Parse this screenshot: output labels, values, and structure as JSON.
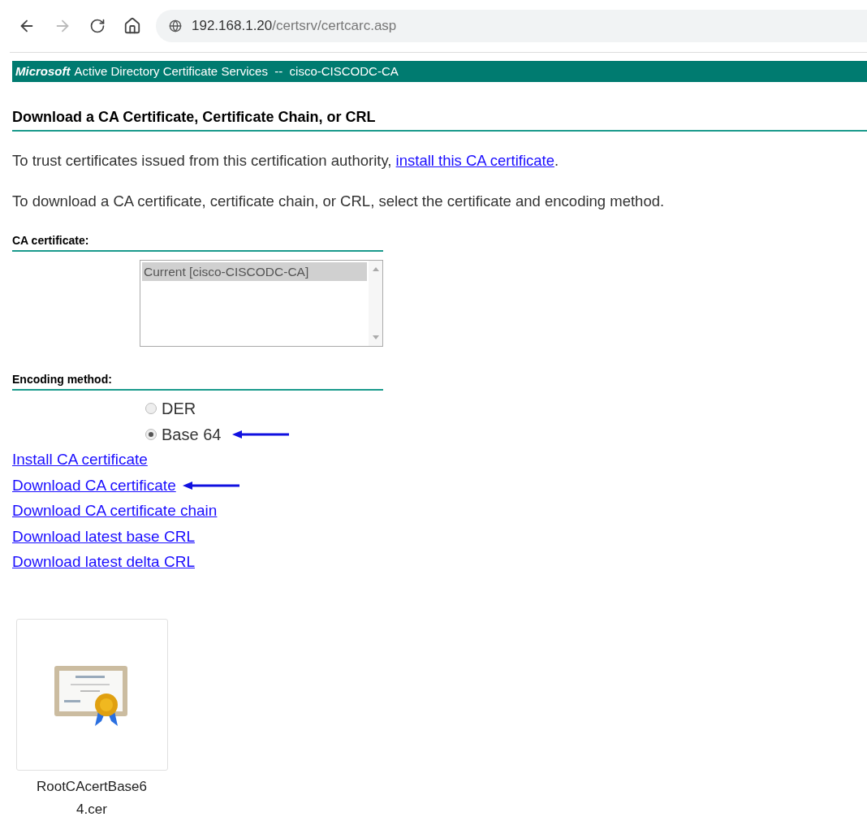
{
  "browser": {
    "address_host": "192.168.1.20",
    "address_path": "/certsrv/certcarc.asp"
  },
  "banner": {
    "brand": "Microsoft",
    "text": "Active Directory Certificate Services  --  cisco-CISCODC-CA"
  },
  "heading": "Download a CA Certificate, Certificate Chain, or CRL",
  "intro": {
    "before": "To trust certificates issued from this certification authority, ",
    "link": "install this CA certificate",
    "after": "."
  },
  "instruction": "To download a CA certificate, certificate chain, or CRL, select the certificate and encoding method.",
  "ca_certificate": {
    "label": "CA certificate:",
    "options": [
      {
        "text": "Current [cisco-CISCODC-CA]",
        "selected": true
      }
    ]
  },
  "encoding": {
    "label": "Encoding method:",
    "options": [
      {
        "text": "DER",
        "selected": false,
        "arrow": false
      },
      {
        "text": "Base 64",
        "selected": true,
        "arrow": true
      }
    ]
  },
  "links": [
    {
      "text": "Install CA certificate",
      "arrow": false
    },
    {
      "text": "Download CA certificate",
      "arrow": true
    },
    {
      "text": "Download CA certificate chain",
      "arrow": false
    },
    {
      "text": "Download latest base CRL",
      "arrow": false
    },
    {
      "text": "Download latest delta CRL",
      "arrow": false
    }
  ],
  "file": {
    "name": "RootCAcertBase64.cer"
  }
}
